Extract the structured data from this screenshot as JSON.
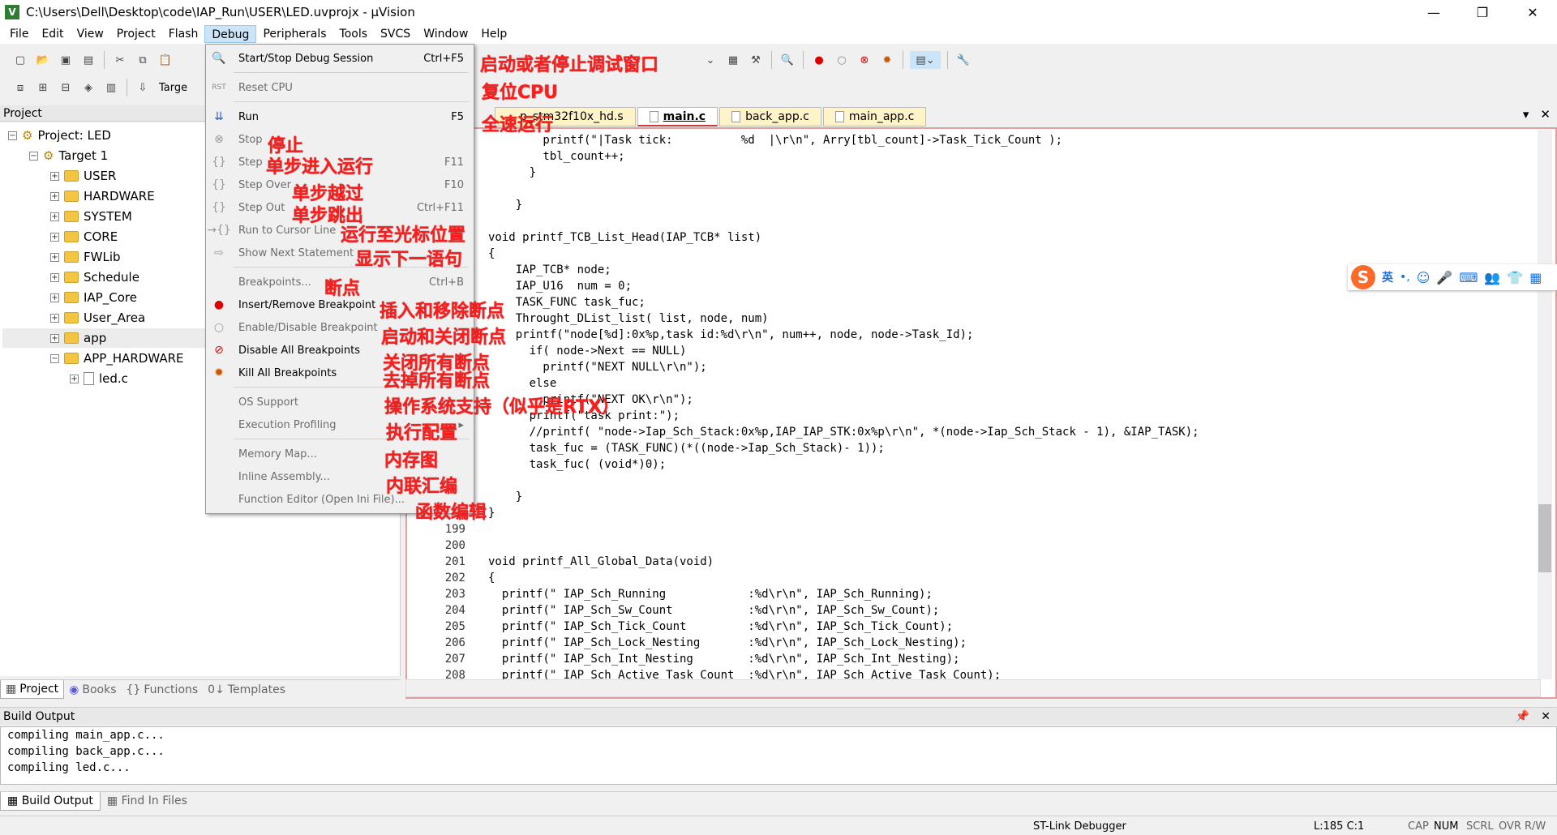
{
  "window": {
    "title": "C:\\Users\\Dell\\Desktop\\code\\IAP_Run\\USER\\LED.uvprojx - µVision",
    "min": "—",
    "max": "❐",
    "close": "✕"
  },
  "menubar": [
    "File",
    "Edit",
    "View",
    "Project",
    "Flash",
    "Debug",
    "Peripherals",
    "Tools",
    "SVCS",
    "Window",
    "Help"
  ],
  "toolbar2_target": "Targe",
  "project_panel": {
    "title": "Project",
    "tree": [
      {
        "label": "Project: LED",
        "exp": "−"
      },
      {
        "label": "Target 1",
        "exp": "−"
      },
      {
        "label": "USER",
        "exp": "+"
      },
      {
        "label": "HARDWARE",
        "exp": "+"
      },
      {
        "label": "SYSTEM",
        "exp": "+"
      },
      {
        "label": "CORE",
        "exp": "+"
      },
      {
        "label": "FWLib",
        "exp": "+"
      },
      {
        "label": "Schedule",
        "exp": "+"
      },
      {
        "label": "IAP_Core",
        "exp": "+"
      },
      {
        "label": "User_Area",
        "exp": "+"
      },
      {
        "label": "app",
        "exp": "+"
      },
      {
        "label": "APP_HARDWARE",
        "exp": "−"
      },
      {
        "label": "led.c",
        "exp": "+"
      }
    ],
    "tabs": [
      "Project",
      "Books",
      "Functions",
      "Templates"
    ]
  },
  "editor": {
    "tabs": [
      "p_stm32f10x_hd.s",
      "main.c",
      "back_app.c",
      "main_app.c"
    ],
    "lines": [
      {
        "n": "",
        "code": "        printf(\"|Task tick:          %d  |\\r\\n\", Arry[tbl_count]->Task_Tick_Count );"
      },
      {
        "n": "",
        "code": "        tbl_count++;"
      },
      {
        "n": "",
        "code": "      }"
      },
      {
        "n": "",
        "code": ""
      },
      {
        "n": "",
        "code": "    }"
      },
      {
        "n": "",
        "code": ""
      },
      {
        "n": "",
        "code": "void printf_TCB_List_Head(IAP_TCB* list)"
      },
      {
        "n": "",
        "code": "{"
      },
      {
        "n": "",
        "code": "    IAP_TCB* node;"
      },
      {
        "n": "",
        "code": "    IAP_U16  num = 0;"
      },
      {
        "n": "",
        "code": "    TASK_FUNC task_fuc;"
      },
      {
        "n": "",
        "code": "    Throught_DList_list( list, node, num)"
      },
      {
        "n": "",
        "code": "    printf(\"node[%d]:0x%p,task id:%d\\r\\n\", num++, node, node->Task_Id);"
      },
      {
        "n": "",
        "code": "      if( node->Next == NULL)"
      },
      {
        "n": "",
        "code": "        printf(\"NEXT NULL\\r\\n\");"
      },
      {
        "n": "",
        "code": "      else"
      },
      {
        "n": "",
        "code": "        printf(\"NEXT OK\\r\\n\");"
      },
      {
        "n": "",
        "code": "      printf(\"task print:\");"
      },
      {
        "n": "",
        "code": "      //printf( \"node->Iap_Sch_Stack:0x%p,IAP_IAP_STK:0x%p\\r\\n\", *(node->Iap_Sch_Stack - 1), &IAP_TASK);"
      },
      {
        "n": "",
        "code": "      task_fuc = (TASK_FUNC)(*((node->Iap_Sch_Stack)- 1));"
      },
      {
        "n": "",
        "code": "      task_fuc( (void*)0);"
      },
      {
        "n": "",
        "code": ""
      },
      {
        "n": "",
        "code": "    }"
      },
      {
        "n": "",
        "code": "}"
      },
      {
        "n": "199",
        "code": ""
      },
      {
        "n": "200",
        "code": ""
      },
      {
        "n": "201",
        "code": "void printf_All_Global_Data(void)"
      },
      {
        "n": "202",
        "code": "{"
      },
      {
        "n": "203",
        "code": "  printf(\" IAP_Sch_Running            :%d\\r\\n\", IAP_Sch_Running);"
      },
      {
        "n": "204",
        "code": "  printf(\" IAP_Sch_Sw_Count           :%d\\r\\n\", IAP_Sch_Sw_Count);"
      },
      {
        "n": "205",
        "code": "  printf(\" IAP_Sch_Tick_Count         :%d\\r\\n\", IAP_Sch_Tick_Count);"
      },
      {
        "n": "206",
        "code": "  printf(\" IAP_Sch_Lock_Nesting       :%d\\r\\n\", IAP_Sch_Lock_Nesting);"
      },
      {
        "n": "207",
        "code": "  printf(\" IAP_Sch_Int_Nesting        :%d\\r\\n\", IAP_Sch_Int_Nesting);"
      },
      {
        "n": "208",
        "code": "  printf(\" IAP_Sch_Active_Task_Count  :%d\\r\\n\", IAP_Sch_Active_Task_Count);"
      }
    ]
  },
  "ime": {
    "lang": "英",
    "punct": "•,",
    "icons": [
      "emoji-icon",
      "mic-icon",
      "keyboard-icon",
      "user-icon",
      "skin-icon",
      "grid-icon"
    ]
  },
  "build_output": {
    "title": "Build Output",
    "lines": [
      "compiling main_app.c...",
      "compiling back_app.c...",
      "compiling led.c..."
    ],
    "tabs": [
      "Build Output",
      "Find In Files"
    ]
  },
  "statusbar": {
    "debugger": "ST-Link Debugger",
    "position": "L:185 C:1",
    "flags": [
      "CAP",
      "NUM",
      "SCRL",
      "OVR",
      "R/W"
    ]
  },
  "debug_menu": [
    {
      "label": "Start/Stop Debug Session",
      "shortcut": "Ctrl+F5",
      "enabled": true
    },
    {
      "label": "Reset CPU",
      "shortcut": "",
      "enabled": false
    },
    {
      "label": "Run",
      "shortcut": "F5",
      "enabled": true
    },
    {
      "label": "Stop",
      "shortcut": "",
      "enabled": false
    },
    {
      "label": "Step",
      "shortcut": "F11",
      "enabled": false
    },
    {
      "label": "Step Over",
      "shortcut": "F10",
      "enabled": false
    },
    {
      "label": "Step Out",
      "shortcut": "Ctrl+F11",
      "enabled": false
    },
    {
      "label": "Run to Cursor Line",
      "shortcut": "",
      "enabled": false
    },
    {
      "label": "Show Next Statement",
      "shortcut": "",
      "enabled": false
    },
    {
      "label": "Breakpoints...",
      "shortcut": "Ctrl+B",
      "enabled": false
    },
    {
      "label": "Insert/Remove Breakpoint",
      "shortcut": "",
      "enabled": true
    },
    {
      "label": "Enable/Disable Breakpoint",
      "shortcut": "Ctrl+F9",
      "enabled": false
    },
    {
      "label": "Disable All Breakpoints",
      "shortcut": "",
      "enabled": true
    },
    {
      "label": "Kill All Breakpoints",
      "shortcut": "",
      "enabled": true
    },
    {
      "label": "OS Support",
      "shortcut": "",
      "enabled": false
    },
    {
      "label": "Execution Profiling",
      "shortcut": "",
      "enabled": false
    },
    {
      "label": "Memory Map...",
      "shortcut": "",
      "enabled": false
    },
    {
      "label": "Inline Assembly...",
      "shortcut": "",
      "enabled": false
    },
    {
      "label": "Function Editor (Open Ini File)...",
      "shortcut": "",
      "enabled": false
    }
  ],
  "annotations": [
    "启动或者停止调试窗口",
    "复位CPU",
    "全速运行",
    "停止",
    "单步进入运行",
    "单步越过",
    "单步跳出",
    "运行至光标位置",
    "显示下一语句",
    "断点",
    "插入和移除断点",
    "启动和关闭断点",
    "关闭所有断点",
    "去掉所有断点",
    "操作系统支持（似乎是RTX）",
    "执行配置",
    "内存图",
    "内联汇编",
    "函数编辑"
  ]
}
